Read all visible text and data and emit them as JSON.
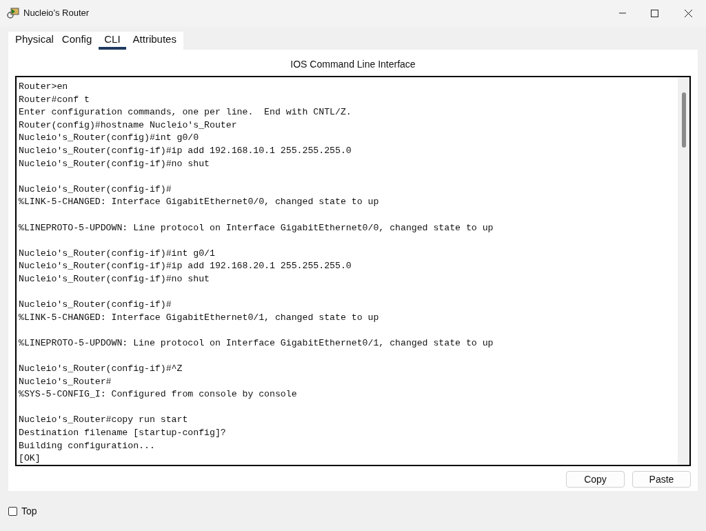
{
  "window": {
    "title": "Nucleio’s Router"
  },
  "tabs": [
    {
      "label": "Physical",
      "selected": false
    },
    {
      "label": "Config",
      "selected": false
    },
    {
      "label": "CLI",
      "selected": true
    },
    {
      "label": "Attributes",
      "selected": false
    }
  ],
  "panel_title": "IOS Command Line Interface",
  "terminal": [
    [
      "Router>en",
      "Router#conf t",
      "Enter configuration commands, one per line.  End with CNTL/Z.",
      "Router(config)#hostname Nucleio's_Router",
      "Nucleio's_Router(config)#int g0/0",
      "Nucleio's_Router(config-if)#ip add 192.168.10.1 255.255.255.0",
      "Nucleio's_Router(config-if)#no shut"
    ],
    [
      "Nucleio's_Router(config-if)#",
      "%LINK-5-CHANGED: Interface GigabitEthernet0/0, changed state to up"
    ],
    [
      "%LINEPROTO-5-UPDOWN: Line protocol on Interface GigabitEthernet0/0, changed state to up"
    ],
    [
      "Nucleio's_Router(config-if)#int g0/1",
      "Nucleio's_Router(config-if)#ip add 192.168.20.1 255.255.255.0",
      "Nucleio's_Router(config-if)#no shut"
    ],
    [
      "Nucleio's_Router(config-if)#",
      "%LINK-5-CHANGED: Interface GigabitEthernet0/1, changed state to up"
    ],
    [
      "%LINEPROTO-5-UPDOWN: Line protocol on Interface GigabitEthernet0/1, changed state to up"
    ],
    [
      "Nucleio's_Router(config-if)#^Z",
      "Nucleio's_Router#",
      "%SYS-5-CONFIG_I: Configured from console by console"
    ],
    [
      "Nucleio's_Router#copy run start",
      "Destination filename [startup-config]?",
      "Building configuration...",
      "[OK]"
    ]
  ],
  "buttons": [
    "Copy",
    "Paste"
  ],
  "top_checkbox": {
    "label": "Top",
    "checked": false
  }
}
